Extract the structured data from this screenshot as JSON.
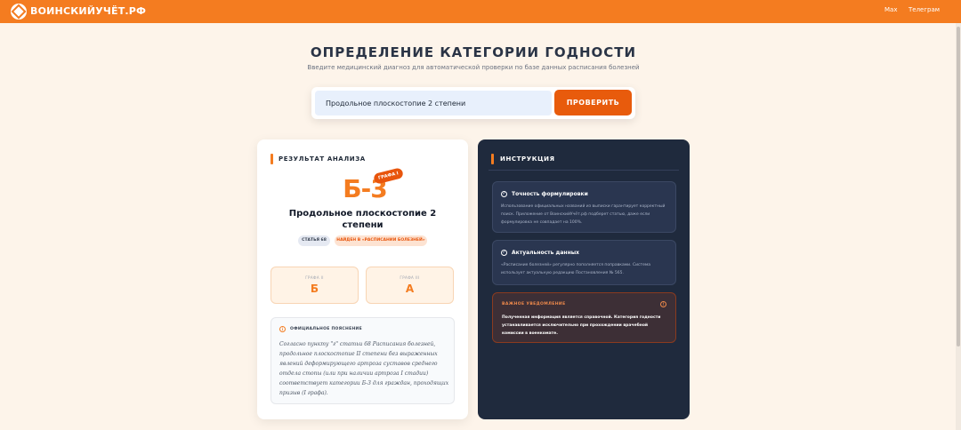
{
  "header": {
    "logo_text": "ВОИНСКИЙУЧЁТ.РФ",
    "nav": [
      "Max",
      "Телеграм"
    ]
  },
  "hero": {
    "title": "ОПРЕДЕЛЕНИЕ КАТЕГОРИИ ГОДНОСТИ",
    "subtitle": "Введите медицинский диагноз для автоматической проверки по базе данных расписания болезней"
  },
  "search": {
    "value": "Продольное плоскостопие 2 степени",
    "button_label": "ПРОВЕРИТЬ"
  },
  "result": {
    "section_title": "РЕЗУЛЬТАТ АНАЛИЗА",
    "category": "Б-3",
    "grafa_tag": "ГРАФА I",
    "diagnosis": "Продольное плоскостопие 2 степени",
    "article_pill": "СТАТЬЯ 68",
    "found_pill": "НАЙДЕН В «РАСПИСАНИИ БОЛЕЗНЕЙ»",
    "grafa2": {
      "label": "ГРАФА II",
      "value": "Б"
    },
    "grafa3": {
      "label": "ГРАФА III",
      "value": "А"
    },
    "explanation_title": "ОФИЦИАЛЬНОЕ ПОЯСНЕНИЕ",
    "explanation_text": "Согласно пункту \"г\" статьи 68 Расписания болезней, продольное плоскостопие II степени без выраженных явлений деформирующего артроза суставов среднего отдела стопы (или при наличии артроза I стадии) соответствует категории Б-3 для граждан, проходящих призыв (I графа)."
  },
  "instructions": {
    "section_title": "ИНСТРУКЦИЯ",
    "items": [
      {
        "title": "Точность формулировки",
        "text": "Использование официальных названий из выписки гарантирует корректный поиск. Приложение от ВоинскийУчёт.рф подберет статью, даже если формулировка не совпадает на 100%."
      },
      {
        "title": "Актуальность данных",
        "text": "«Расписание болезней» регулярно пополняется поправками. Система использует актуальную редакцию Постановления № 565."
      }
    ],
    "warning_title": "ВАЖНОЕ УВЕДОМЛЕНИЕ",
    "warning_text": "Полученная информация является справочной. Категория годности устанавливается исключительно при прохождении врачебной комиссии в военкомате."
  }
}
